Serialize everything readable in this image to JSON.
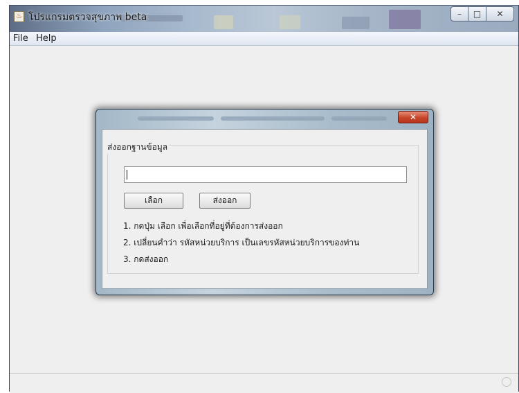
{
  "window": {
    "title": "โปรแกรมตรวจสุขภาพ beta",
    "min_label": "–",
    "max_label": "□",
    "close_label": "✕"
  },
  "menu": {
    "items": [
      "File",
      "Help"
    ]
  },
  "dialog": {
    "close_label": "✕",
    "group_title": "ส่งออกฐานข้อมูล",
    "path_value": "",
    "select_label": "เลือก",
    "export_label": "ส่งออก",
    "instructions": [
      "1. กดปุ่ม เลือก เพื่อเลือกที่อยู่ที่ต้องการส่งออก",
      "2. เปลี่ยนคำว่า รหัสหน่วยบริการ เป็นเลขรหัสหน่วยบริการของท่าน",
      "3. กดส่งออก"
    ]
  },
  "icons": {
    "app": "java-coffee-icon",
    "status": "busy-indicator-icon"
  }
}
